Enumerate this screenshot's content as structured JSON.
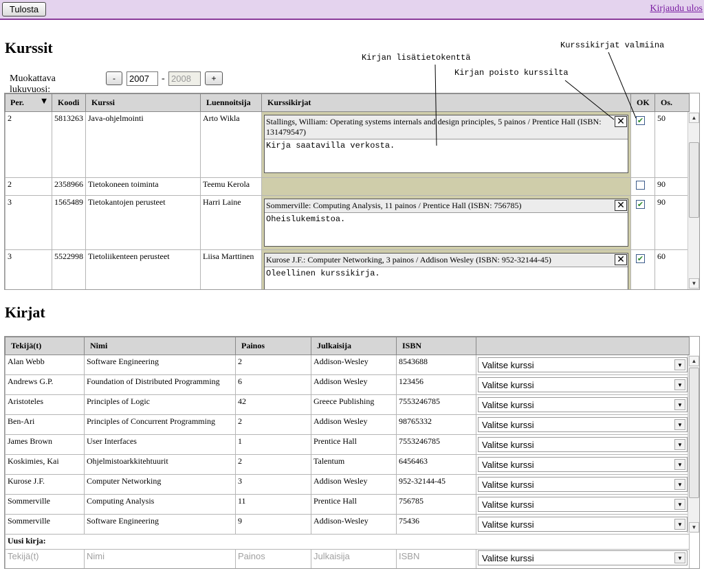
{
  "topbar": {
    "print_label": "Tulosta",
    "logout_label": "Kirjaudu ulos"
  },
  "courses": {
    "title": "Kurssit",
    "year_label": "Muokattava lukuvuosi:",
    "minus": "-",
    "plus": "+",
    "year_from": "2007",
    "year_sep": "-",
    "year_to": "2008",
    "headers": [
      "Per.",
      "Koodi",
      "Kurssi",
      "Luennoitsija",
      "Kurssikirjat",
      "OK",
      "Os."
    ],
    "rows": [
      {
        "per": "2",
        "code": "5813263",
        "name": "Java-ohjelmointi",
        "lecturer": "Arto Wikla",
        "book": "Stallings, William: Operating systems internals and design principles, 5 painos / Prentice Hall (ISBN: 131479547)",
        "note": "Kirja saatavilla verkosta.",
        "ok": true,
        "os": "50"
      },
      {
        "per": "2",
        "code": "2358966",
        "name": "Tietokoneen toiminta",
        "lecturer": "Teemu Kerola",
        "book": "",
        "note": "",
        "ok": false,
        "os": "90"
      },
      {
        "per": "3",
        "code": "1565489",
        "name": "Tietokantojen perusteet",
        "lecturer": "Harri Laine",
        "book": "Sommerville: Computing Analysis, 11 painos / Prentice Hall (ISBN: 756785)",
        "note": "Oheislukemistoa.",
        "ok": true,
        "os": "90"
      },
      {
        "per": "3",
        "code": "5522998",
        "name": "Tietoliikenteen perusteet",
        "lecturer": "Liisa Marttinen",
        "book": "Kurose J.F.: Computer Networking, 3 painos / Addison Wesley (ISBN: 952-32144-45)",
        "note": "Oleellinen kurssikirja.",
        "ok": true,
        "os": "60"
      }
    ]
  },
  "annotations": {
    "ready": "Kurssikirjat valmiina",
    "info_field": "Kirjan lisätietokenttä",
    "remove": "Kirjan poisto kurssilta"
  },
  "books": {
    "title": "Kirjat",
    "headers": [
      "Tekijä(t)",
      "Nimi",
      "Painos",
      "Julkaisija",
      "ISBN"
    ],
    "select_label": "Valitse kurssi",
    "rows": [
      {
        "author": "Alan Webb",
        "name": "Software Engineering",
        "edition": "2",
        "publisher": "Addison-Wesley",
        "isbn": "8543688"
      },
      {
        "author": "Andrews G.P.",
        "name": "Foundation of Distributed Programming",
        "edition": "6",
        "publisher": "Addison Wesley",
        "isbn": "123456"
      },
      {
        "author": "Aristoteles",
        "name": "Principles of Logic",
        "edition": "42",
        "publisher": "Greece Publishing",
        "isbn": "7553246785"
      },
      {
        "author": "Ben-Ari",
        "name": "Principles of Concurrent Programming",
        "edition": "2",
        "publisher": "Addison Wesley",
        "isbn": "98765332"
      },
      {
        "author": "James Brown",
        "name": "User Interfaces",
        "edition": "1",
        "publisher": "Prentice Hall",
        "isbn": "7553246785"
      },
      {
        "author": "Koskimies, Kai",
        "name": "Ohjelmistoarkkitehtuurit",
        "edition": "2",
        "publisher": "Talentum",
        "isbn": "6456463"
      },
      {
        "author": "Kurose J.F.",
        "name": "Computer Networking",
        "edition": "3",
        "publisher": "Addison Wesley",
        "isbn": "952-32144-45"
      },
      {
        "author": "Sommerville",
        "name": "Computing Analysis",
        "edition": "11",
        "publisher": "Prentice Hall",
        "isbn": "756785"
      },
      {
        "author": "Sommerville",
        "name": "Software Engineering",
        "edition": "9",
        "publisher": "Addison-Wesley",
        "isbn": "75436"
      }
    ],
    "new_label": "Uusi kirja:",
    "new_placeholders": {
      "author": "Tekijä(t)",
      "name": "Nimi",
      "edition": "Painos",
      "publisher": "Julkaisija",
      "isbn": "ISBN"
    }
  }
}
